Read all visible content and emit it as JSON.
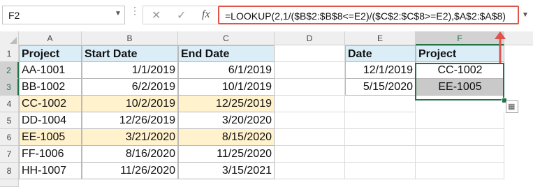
{
  "formula_bar": {
    "name_box": "F2",
    "cancel_glyph": "✕",
    "enter_glyph": "✓",
    "fx_label": "fx",
    "formula": "=LOOKUP(2,1/($B$2:$B$8<=E2)/($C$2:$C$8>=E2),$A$2:$A$8)"
  },
  "columns": [
    "A",
    "B",
    "C",
    "D",
    "E",
    "F"
  ],
  "rows": [
    "1",
    "2",
    "3",
    "4",
    "5",
    "6",
    "7",
    "8"
  ],
  "table1": {
    "headers": [
      "Project",
      "Start Date",
      "End Date"
    ],
    "rows": [
      [
        "AA-1001",
        "1/1/2019",
        "6/1/2019"
      ],
      [
        "BB-1002",
        "6/2/2019",
        "10/1/2019"
      ],
      [
        "CC-1002",
        "10/2/2019",
        "12/25/2019"
      ],
      [
        "DD-1004",
        "12/26/2019",
        "3/20/2020"
      ],
      [
        "EE-1005",
        "3/21/2020",
        "8/15/2020"
      ],
      [
        "FF-1006",
        "8/16/2020",
        "11/25/2020"
      ],
      [
        "HH-1007",
        "11/26/2020",
        "3/15/2021"
      ]
    ]
  },
  "table2": {
    "headers": [
      "Date",
      "Project"
    ],
    "rows": [
      [
        "12/1/2019",
        "CC-1002"
      ],
      [
        "5/15/2020",
        "EE-1005"
      ]
    ]
  },
  "colors": {
    "header_fill": "#dbeef8",
    "highlight_fill": "#fff2cc",
    "selection_green": "#217346",
    "annotation_red": "#e0524a"
  },
  "icons": [
    "dropdown-caret-icon",
    "cancel-icon",
    "enter-icon",
    "fx-icon",
    "quick-analysis-icon",
    "red-arrow-icon"
  ]
}
